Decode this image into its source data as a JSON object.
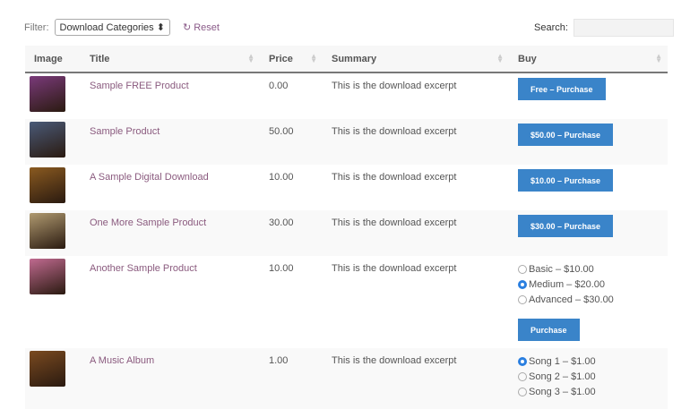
{
  "filter": {
    "label": "Filter:",
    "select": "Download Categories",
    "reset": "Reset"
  },
  "search": {
    "label": "Search:",
    "value": ""
  },
  "columns": [
    "Image",
    "Title",
    "Price",
    "Summary",
    "Buy"
  ],
  "rows": [
    {
      "title": "Sample FREE Product",
      "price": "0.00",
      "summary": "This is the download excerpt",
      "button": "Free – Purchase",
      "color": "#7a3a7a"
    },
    {
      "title": "Sample Product",
      "price": "50.00",
      "summary": "This is the download excerpt",
      "button": "$50.00 – Purchase",
      "color": "#4a5a78"
    },
    {
      "title": "A Sample Digital Download",
      "price": "10.00",
      "summary": "This is the download excerpt",
      "button": "$10.00 – Purchase",
      "color": "#8a5a20"
    },
    {
      "title": "One More Sample Product",
      "price": "30.00",
      "summary": "This is the download excerpt",
      "button": "$30.00 – Purchase",
      "color": "#b09a70"
    },
    {
      "title": "Another Sample Product",
      "price": "10.00",
      "summary": "This is the download excerpt",
      "options": [
        {
          "label": "Basic – $10.00",
          "checked": false
        },
        {
          "label": "Medium – $20.00",
          "checked": true
        },
        {
          "label": "Advanced – $30.00",
          "checked": false
        }
      ],
      "button": "Purchase",
      "color": "#c06a90"
    },
    {
      "title": "A Music Album",
      "price": "1.00",
      "summary": "This is the download excerpt",
      "options": [
        {
          "label": "Song 1 – $1.00",
          "checked": true
        },
        {
          "label": "Song 2 – $1.00",
          "checked": false
        },
        {
          "label": "Song 3 – $1.00",
          "checked": false
        }
      ],
      "color": "#7a4a20"
    }
  ]
}
